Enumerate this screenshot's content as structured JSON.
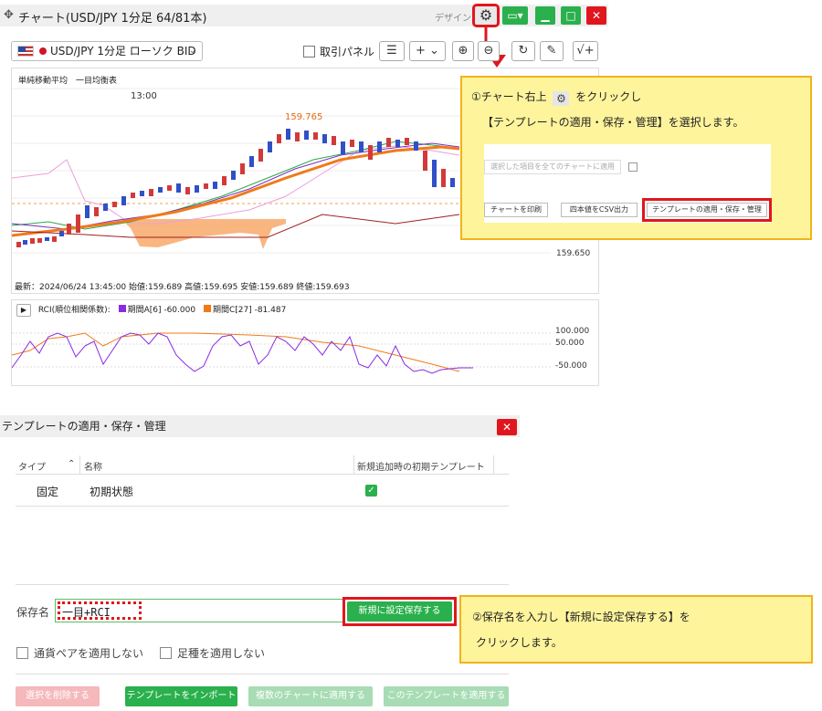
{
  "chart_window": {
    "title": "チャート(USD/JPY 1分足 64/81本)",
    "design_label": "デザイン",
    "symbol_select": "USD/JPY 1分足 ローソク BID",
    "panel_checkbox_label": "取引パネル",
    "legend": "単純移動平均　一目均衡表",
    "time_label": "13:00",
    "price_high_label": "159.765",
    "axis_price_label": "159.650",
    "cut_label": "159",
    "status_line": "最新：2024/06/24 13:45:00 始値:159.689 高値:159.695 安値:159.689 終値:159.693"
  },
  "rci": {
    "label": "RCI(順位相関係数):",
    "series_a": "期間A[6] -60.000",
    "series_c": "期間C[27] -81.487",
    "axis_100": "100.000",
    "axis_50": "50.000",
    "axis_m50": "-50.000"
  },
  "callout1": {
    "line1_pre": "①チャート右上",
    "line1_post": "をクリックし",
    "line2": "【テンプレートの適用・保存・管理】を選択します。",
    "snip_apply_all": "選択した項目を全てのチャートに適用",
    "snip_print": "チャートを印刷",
    "snip_csv": "四本値をCSV出力",
    "snip_template": "テンプレートの適用・保存・管理"
  },
  "dialog": {
    "title": "テンプレートの適用・保存・管理",
    "col_type": "タイプ",
    "col_name": "名称",
    "col_default": "新規追加時の初期テンプレート",
    "rows": [
      {
        "type": "固定",
        "name": "初期状態"
      }
    ],
    "save_label": "保存名",
    "save_value": "一目+RCI",
    "save_button": "新規に設定保存する",
    "opt_pair": "通貨ペアを適用しない",
    "opt_ashi": "足種を適用しない",
    "btn_delete": "選択を削除する",
    "btn_import": "テンプレートをインポート",
    "btn_apply_multi": "複数のチャートに適用する",
    "btn_apply_this": "このテンプレートを適用する"
  },
  "callout2": {
    "line1": "②保存名を入力し【新規に設定保存する】を",
    "line2": "クリックします。"
  },
  "colors": {
    "green": "#2ab04d",
    "red": "#e0161e",
    "callout_bg": "#fef49c",
    "callout_border": "#f0b41b"
  }
}
